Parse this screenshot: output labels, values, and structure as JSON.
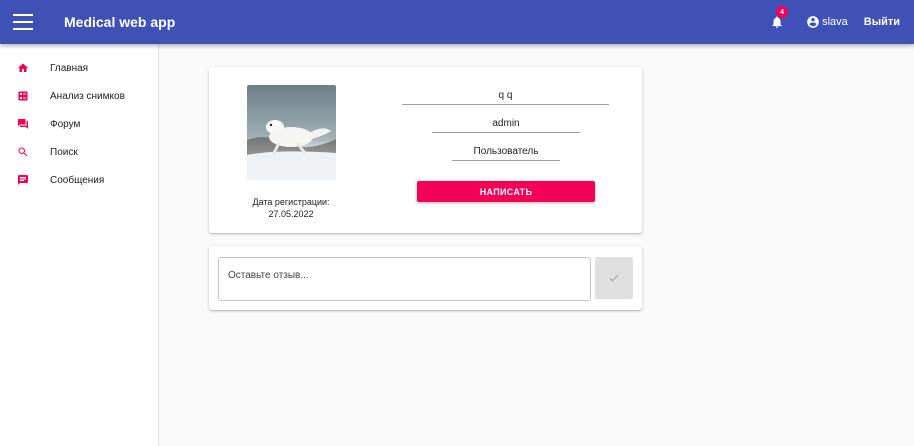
{
  "app": {
    "title": "Medical web app"
  },
  "header": {
    "notifications_count": "4",
    "username": "slava",
    "logout_label": "Выйти"
  },
  "sidebar": {
    "items": [
      {
        "label": "Главная",
        "icon": "home-icon"
      },
      {
        "label": "Анализ снимков",
        "icon": "analysis-icon"
      },
      {
        "label": "Форум",
        "icon": "forum-icon"
      },
      {
        "label": "Поиск",
        "icon": "search-icon"
      },
      {
        "label": "Сообщения",
        "icon": "message-icon"
      }
    ]
  },
  "profile": {
    "name": "q q",
    "login": "admin",
    "role": "Пользователь",
    "registration_label": "Дата регистрации:",
    "registration_date": "27.05.2022",
    "write_button": "НАПИСАТЬ"
  },
  "review": {
    "placeholder": "Оставьте отзыв..."
  },
  "colors": {
    "primary": "#3f51b5",
    "accent": "#f50057"
  }
}
